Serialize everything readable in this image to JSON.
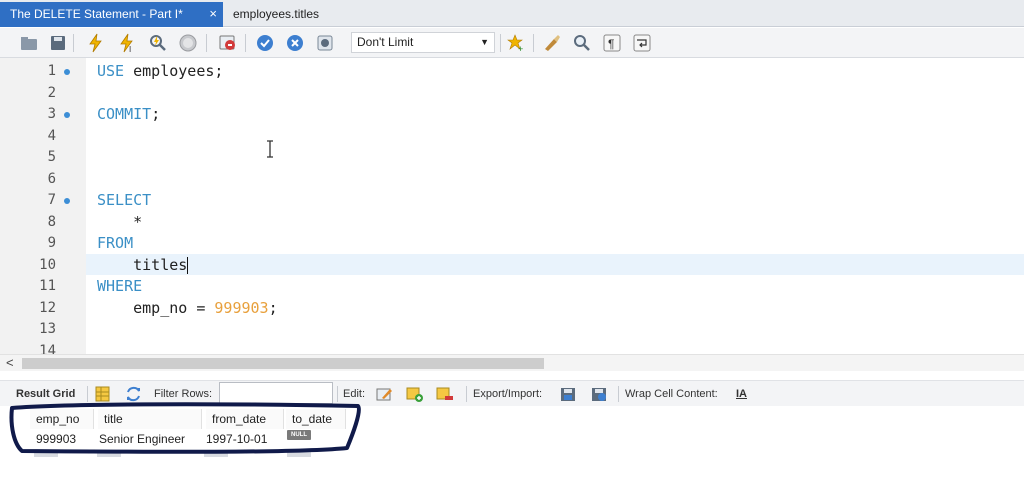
{
  "tabs": [
    {
      "label": "The DELETE Statement - Part I*",
      "close": "×"
    },
    {
      "label": "employees.titles"
    }
  ],
  "toolbar": {
    "limit_select": "Don't Limit",
    "icons": [
      "open-folder-icon",
      "save-icon",
      "execute-icon",
      "execute-current-icon",
      "explain-icon",
      "stop-icon",
      "toggle-results-icon",
      "commit-icon",
      "rollback-icon",
      "autocommit-icon",
      "add-snippet-icon",
      "beautify-icon",
      "find-icon",
      "invisible-chars-icon",
      "word-wrap-icon"
    ]
  },
  "editor": {
    "lines": [
      {
        "n": "1",
        "dot": true
      },
      {
        "n": "2",
        "dot": false
      },
      {
        "n": "3",
        "dot": true
      },
      {
        "n": "4",
        "dot": false
      },
      {
        "n": "5",
        "dot": false
      },
      {
        "n": "6",
        "dot": false
      },
      {
        "n": "7",
        "dot": true
      },
      {
        "n": "8",
        "dot": false
      },
      {
        "n": "9",
        "dot": false
      },
      {
        "n": "10",
        "dot": false
      },
      {
        "n": "11",
        "dot": false
      },
      {
        "n": "12",
        "dot": false
      },
      {
        "n": "13",
        "dot": false
      },
      {
        "n": "14",
        "dot": false
      }
    ],
    "code": {
      "l1_kw": "USE",
      "l1_rest": " employees;",
      "l3_kw": "COMMIT",
      "l3_rest": ";",
      "l7_kw": "SELECT",
      "l8": "    *",
      "l9_kw": "FROM",
      "l10": "    titles",
      "l11_kw": "WHERE",
      "l12_pre": "    emp_no = ",
      "l12_num": "999903",
      "l12_post": ";"
    }
  },
  "scrollbar": {
    "left_arrow": "<"
  },
  "result_toolbar": {
    "result_grid": "Result Grid",
    "filter_rows": "Filter Rows:",
    "filter_value": "",
    "edit": "Edit:",
    "export_import": "Export/Import:",
    "wrap_cell": "Wrap Cell Content:",
    "wrap_icon": "IA"
  },
  "grid": {
    "columns": [
      "emp_no",
      "title",
      "from_date",
      "to_date"
    ],
    "rows": [
      [
        "999903",
        "Senior Engineer",
        "1997-10-01",
        "NULL"
      ]
    ]
  },
  "colors": {
    "tab_active": "#2f6fc4",
    "keyword": "#3a8fc6",
    "number": "#e8a03c",
    "annotation": "#101a4a"
  }
}
